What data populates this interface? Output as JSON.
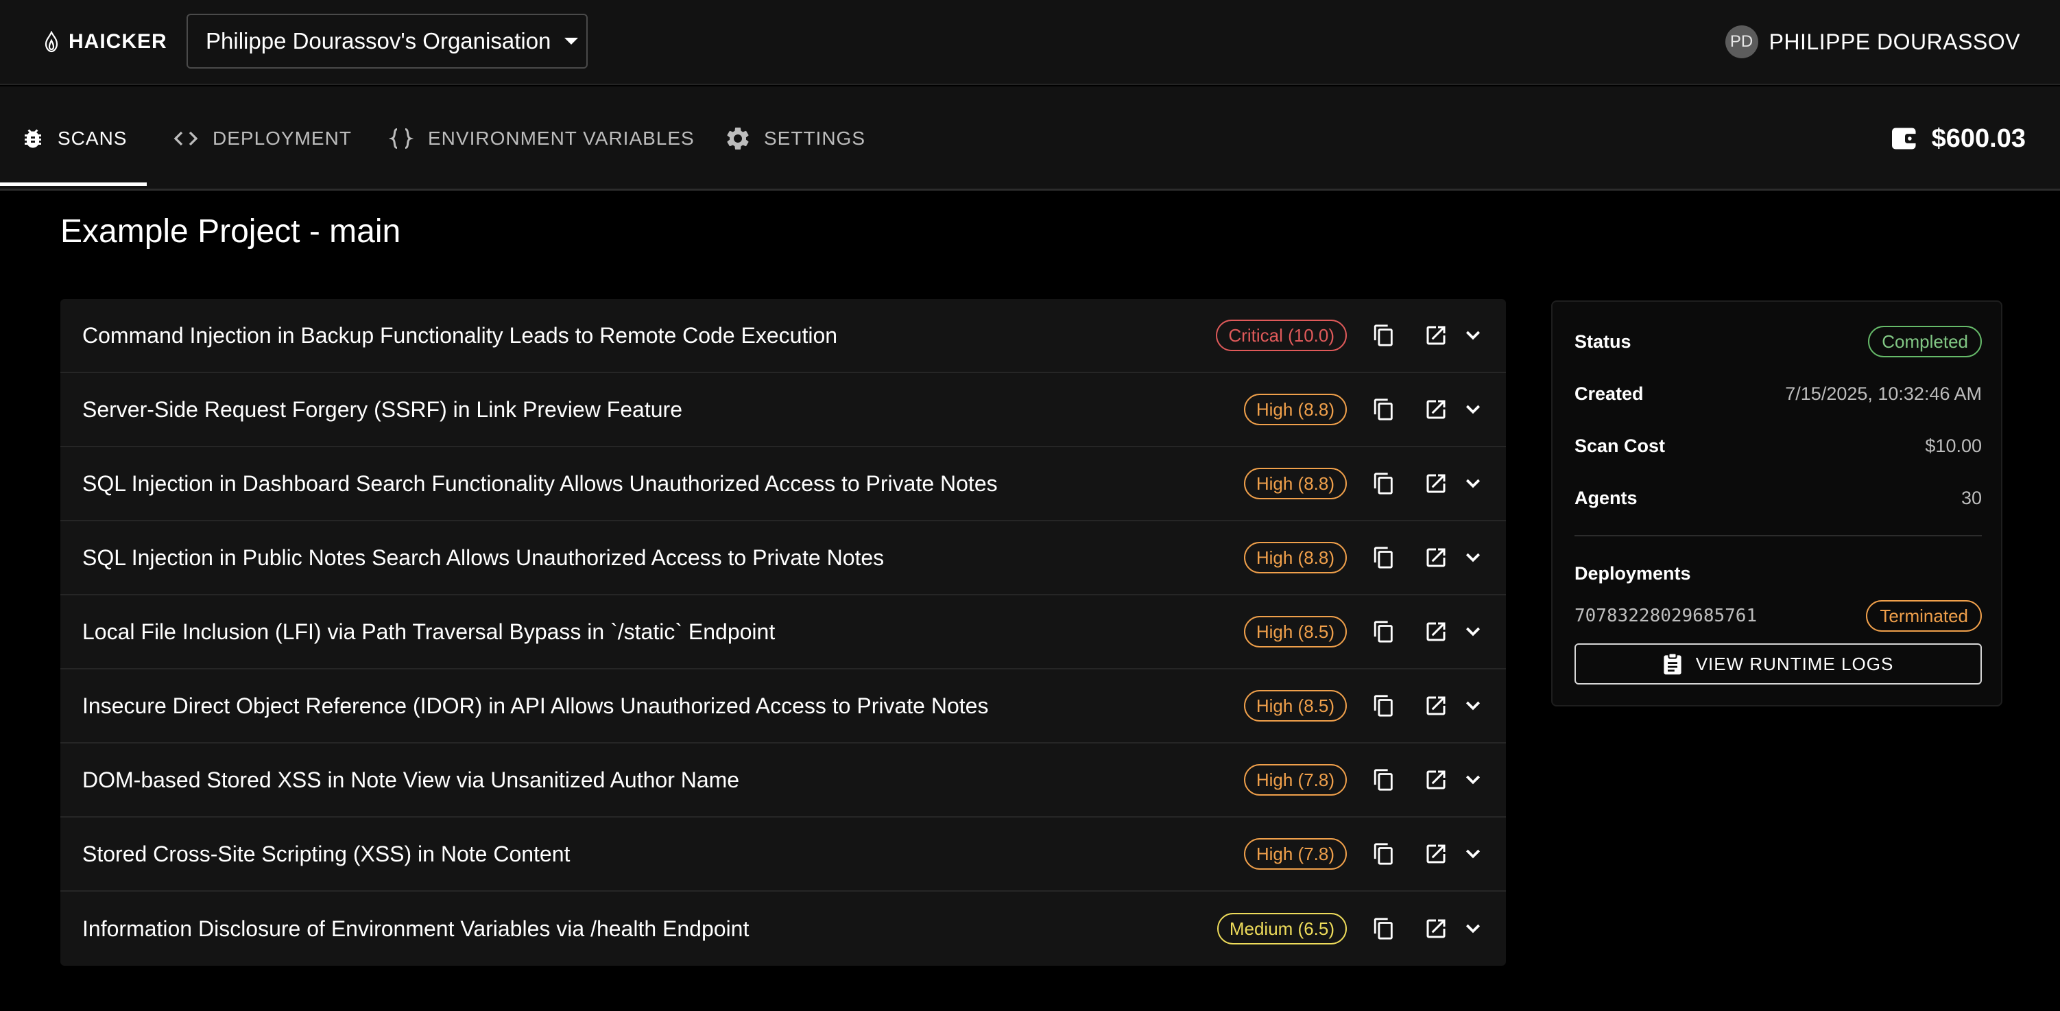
{
  "brand": {
    "name": "HAICKER"
  },
  "org": {
    "selected": "Philippe Dourassov's Organisation"
  },
  "user": {
    "initials": "PD",
    "name": "PHILIPPE DOURASSOV"
  },
  "nav": {
    "tabs": [
      {
        "label": "SCANS",
        "icon": "bug-icon",
        "active": true
      },
      {
        "label": "DEPLOYMENT",
        "icon": "code-icon"
      },
      {
        "label": "ENVIRONMENT VARIABLES",
        "icon": "braces-icon"
      },
      {
        "label": "SETTINGS",
        "icon": "gear-icon"
      }
    ],
    "balance": "$600.03"
  },
  "project": {
    "title": "Example Project - main"
  },
  "findings": [
    {
      "title": "Command Injection in Backup Functionality Leads to Remote Code Execution",
      "severity": "Critical (10.0)",
      "level": "critical"
    },
    {
      "title": "Server-Side Request Forgery (SSRF) in Link Preview Feature",
      "severity": "High (8.8)",
      "level": "high"
    },
    {
      "title": "SQL Injection in Dashboard Search Functionality Allows Unauthorized Access to Private Notes",
      "severity": "High (8.8)",
      "level": "high"
    },
    {
      "title": "SQL Injection in Public Notes Search Allows Unauthorized Access to Private Notes",
      "severity": "High (8.8)",
      "level": "high"
    },
    {
      "title": "Local File Inclusion (LFI) via Path Traversal Bypass in `/static` Endpoint",
      "severity": "High (8.5)",
      "level": "high"
    },
    {
      "title": "Insecure Direct Object Reference (IDOR) in API Allows Unauthorized Access to Private Notes",
      "severity": "High (8.5)",
      "level": "high"
    },
    {
      "title": "DOM-based Stored XSS in Note View via Unsanitized Author Name",
      "severity": "High (7.8)",
      "level": "high"
    },
    {
      "title": "Stored Cross-Site Scripting (XSS) in Note Content",
      "severity": "High (7.8)",
      "level": "high"
    },
    {
      "title": "Information Disclosure of Environment Variables via /health Endpoint",
      "severity": "Medium (6.5)",
      "level": "medium"
    }
  ],
  "colors": {
    "critical": "#e05a5a",
    "high": "#f0a04b",
    "medium": "#eedc5b",
    "completed": "#81c784"
  },
  "panel": {
    "status_label": "Status",
    "status_value": "Completed",
    "created_label": "Created",
    "created_value": "7/15/2025, 10:32:46 AM",
    "cost_label": "Scan Cost",
    "cost_value": "$10.00",
    "agents_label": "Agents",
    "agents_value": "30",
    "deployments_label": "Deployments",
    "deployment_id": "70783228029685761",
    "deployment_status": "Terminated",
    "logs_button": "VIEW RUNTIME LOGS"
  }
}
